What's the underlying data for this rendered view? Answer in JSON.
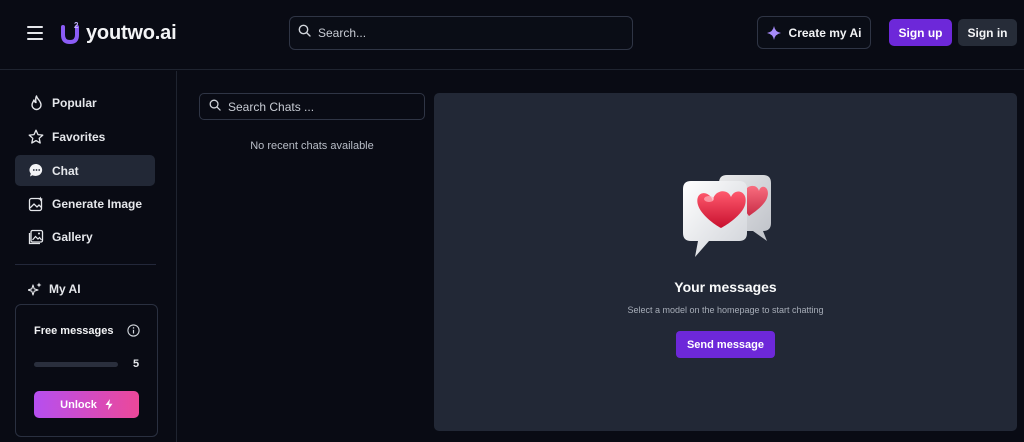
{
  "header": {
    "brand": "youtwo.ai",
    "search_placeholder": "Search...",
    "create_label": "Create my Ai",
    "signup_label": "Sign up",
    "signin_label": "Sign in"
  },
  "sidebar": {
    "items": [
      {
        "label": "Popular",
        "icon": "flame-icon"
      },
      {
        "label": "Favorites",
        "icon": "star-icon"
      },
      {
        "label": "Chat",
        "icon": "chat-bubble-icon",
        "active": true
      },
      {
        "label": "Generate Image",
        "icon": "image-generate-icon"
      },
      {
        "label": "Gallery",
        "icon": "gallery-icon"
      }
    ],
    "my_ai_label": "My AI",
    "free_messages": {
      "title": "Free messages",
      "count": "5",
      "progress": 0.0,
      "unlock_label": "Unlock"
    }
  },
  "chats": {
    "search_placeholder": "Search Chats ...",
    "empty_text": "No recent chats available"
  },
  "main": {
    "title": "Your messages",
    "subtitle": "Select a model on the homepage to start chatting",
    "send_label": "Send message"
  },
  "colors": {
    "accent": "#6d28d9",
    "background": "#090b14",
    "panel": "#222836",
    "heart": "#e3263b"
  }
}
